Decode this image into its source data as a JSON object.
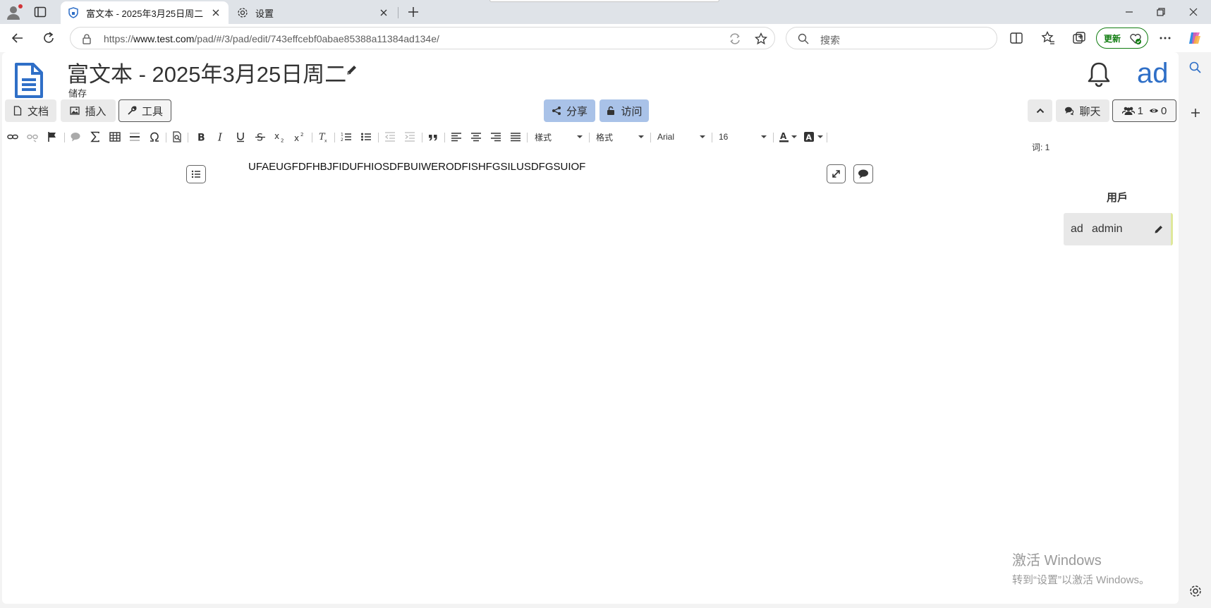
{
  "browser": {
    "tabs": [
      {
        "title": "富文本 - 2025年3月25日周二",
        "active": true
      },
      {
        "title": "设置",
        "active": false
      }
    ],
    "url_prefix": "https://",
    "url_host": "www.test.com",
    "url_path": "/pad/#/3/pad/edit/743effcebf0abae85388a11384ad134e/",
    "search_placeholder": "搜索",
    "update_label": "更新"
  },
  "pad": {
    "title": "富文本 - 2025年3月25日周二",
    "save_status": "储存",
    "avatar_initials": "ad"
  },
  "buttons": {
    "file": "文档",
    "insert": "插入",
    "tools": "工具",
    "share": "分享",
    "access": "访问",
    "chat": "聊天",
    "editors_count": "1",
    "viewers_count": "0"
  },
  "editor_toolbar": {
    "style_dropdown": "樣式",
    "format_dropdown": "格式",
    "font_dropdown": "Arial",
    "size_dropdown": "16",
    "word_count": "词: 1"
  },
  "document": {
    "text": "UFAEUGFDFHBJFIDUFHIOSDFBUIWERODFISHFGSILUSDFGSUIOF"
  },
  "users_panel": {
    "title": "用戶",
    "users": [
      {
        "initials": "ad",
        "name": "admin"
      }
    ]
  },
  "watermark": {
    "line1": "激活 Windows",
    "line2": "转到“设置”以激活 Windows。"
  },
  "colors": {
    "accent_blue": "#2f6fc7",
    "share_button": "#a9c2e8",
    "update_green": "#107c10"
  }
}
